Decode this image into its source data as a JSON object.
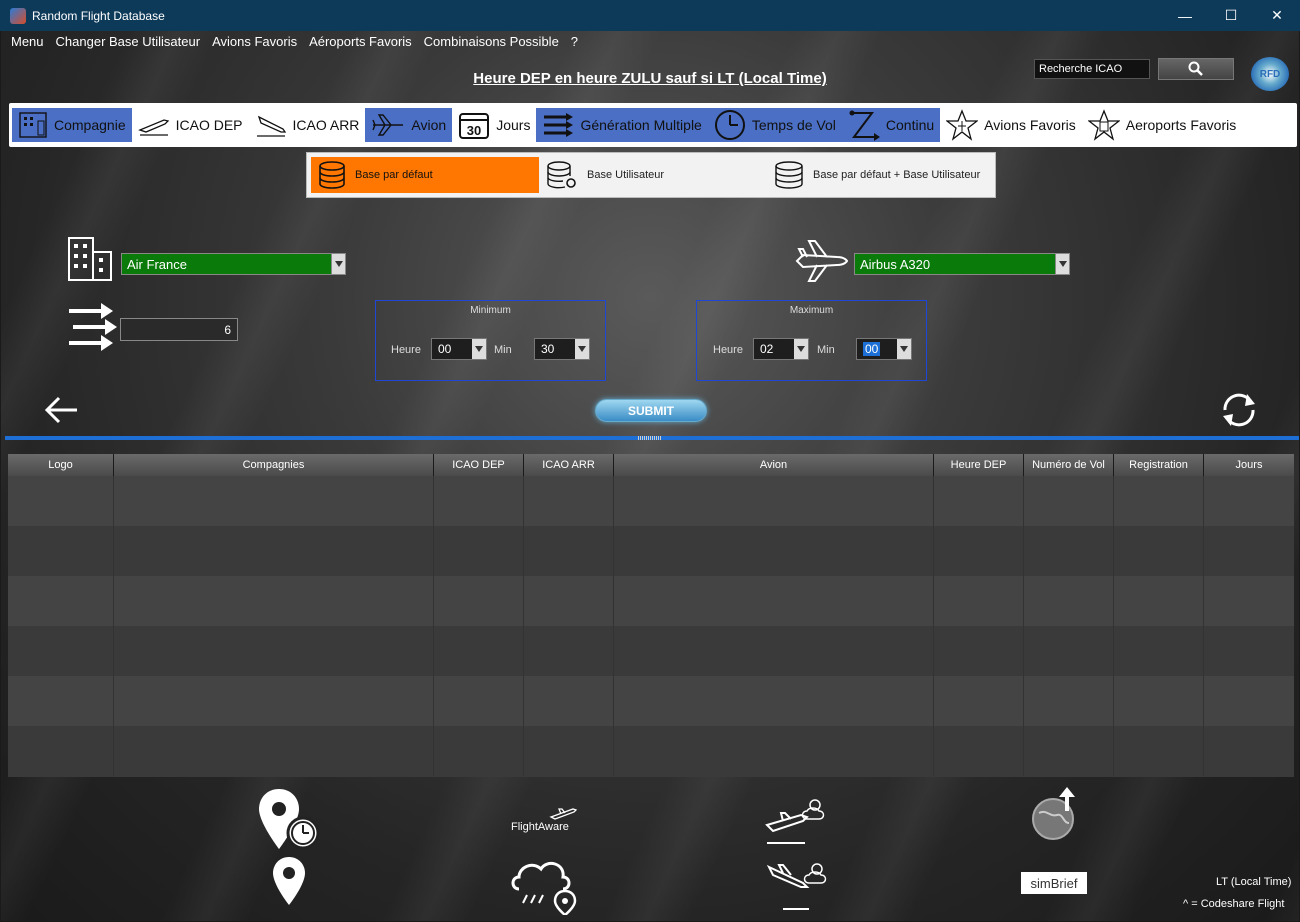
{
  "window": {
    "title": "Random Flight Database",
    "minimize": "—",
    "maximize": "☐",
    "close": "✕"
  },
  "menu": [
    "Menu",
    "Changer Base Utilisateur",
    "Avions Favoris",
    "Aéroports Favoris",
    "Combinaisons Possible",
    "?"
  ],
  "heading": "Heure DEP en heure ZULU sauf si LT (Local Time)",
  "search": {
    "placeholder": "Recherche ICAO",
    "value": "Recherche ICAO"
  },
  "logo_text": "RFD",
  "tabs": [
    {
      "label": "Compagnie",
      "icon": "building-icon",
      "selected": true
    },
    {
      "label": "ICAO DEP",
      "icon": "takeoff-icon",
      "selected": false
    },
    {
      "label": "ICAO ARR",
      "icon": "landing-icon",
      "selected": false
    },
    {
      "label": "Avion",
      "icon": "airplane-icon",
      "selected": true
    },
    {
      "label": "Jours",
      "icon": "calendar-icon",
      "selected": false
    },
    {
      "label": "Génération Multiple",
      "icon": "multi-arrow-icon",
      "selected": true
    },
    {
      "label": "Temps de Vol",
      "icon": "clock-icon",
      "selected": true
    },
    {
      "label": "Continu",
      "icon": "zigzag-icon",
      "selected": true
    },
    {
      "label": "Avions Favoris",
      "icon": "star-plane-icon",
      "selected": false
    },
    {
      "label": "Aeroports Favoris",
      "icon": "star-building-icon",
      "selected": false
    }
  ],
  "calendar_day": "30",
  "base_options": [
    {
      "label": "Base par défaut",
      "selected": true
    },
    {
      "label": "Base Utilisateur",
      "selected": false
    },
    {
      "label": "Base par défaut + Base Utilisateur",
      "selected": false
    }
  ],
  "company_select": "Air France",
  "aircraft_select": "Airbus A320",
  "generation_count": "6",
  "minimum": {
    "label": "Minimum",
    "heure_label": "Heure",
    "min_label": "Min",
    "heure": "00",
    "min": "30"
  },
  "maximum": {
    "label": "Maximum",
    "heure_label": "Heure",
    "min_label": "Min",
    "heure": "02",
    "min": "00"
  },
  "submit_label": "SUBMIT",
  "table": {
    "columns": [
      "Logo",
      "Compagnies",
      "ICAO DEP",
      "ICAO ARR",
      "Avion",
      "Heure DEP",
      "Numéro de Vol",
      "Registration",
      "Jours"
    ],
    "rows": [
      [],
      [],
      [],
      [],
      [],
      []
    ]
  },
  "footer": {
    "flightaware": "FlightAware",
    "simbrief": "simBrief",
    "lt_note": "LT (Local Time)",
    "codeshare_note": "^ = Codeshare Flight"
  },
  "colors": {
    "accent_blue": "#1d6fd6",
    "selected_orange": "#ff7700",
    "combo_green": "#0a7a0a",
    "tab_blue": "#4a6fc4"
  }
}
